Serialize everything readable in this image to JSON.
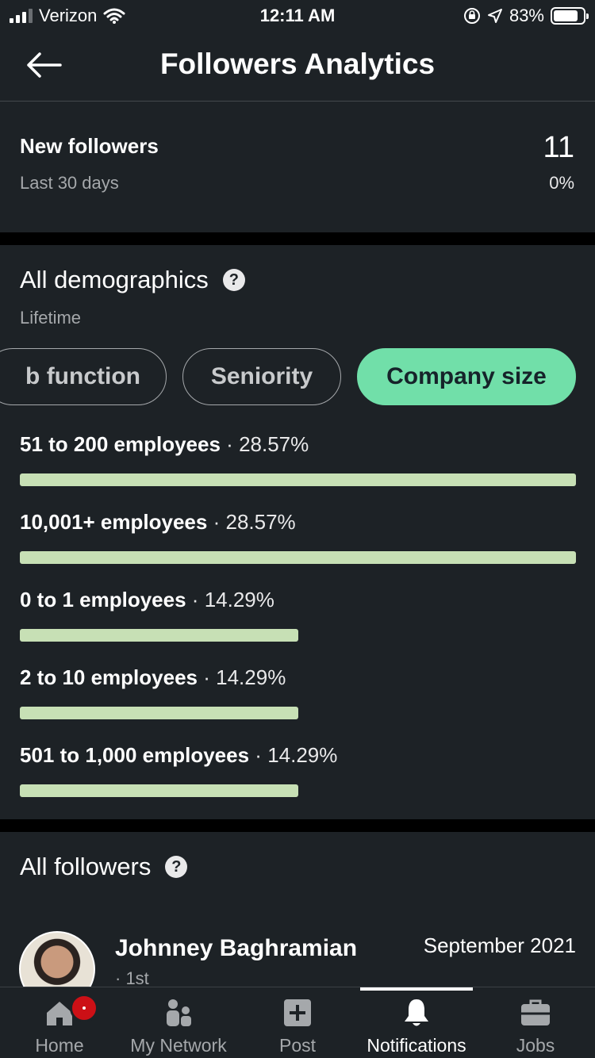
{
  "status_bar": {
    "carrier": "Verizon",
    "time": "12:11 AM",
    "battery": "83%",
    "battery_level": 0.83
  },
  "header": {
    "title": "Followers Analytics"
  },
  "new_followers": {
    "label": "New followers",
    "period": "Last 30 days",
    "count": "11",
    "change": "0%"
  },
  "demographics": {
    "title": "All demographics",
    "period": "Lifetime",
    "tabs": [
      {
        "label": "b function"
      },
      {
        "label": "Seniority"
      },
      {
        "label": "Company size"
      }
    ],
    "active_tab": "Company size",
    "rows": [
      {
        "label": "51 to 200 employees",
        "sep": "·",
        "value": "28.57%",
        "fraction": 1.0
      },
      {
        "label": "10,001+ employees",
        "sep": "·",
        "value": "28.57%",
        "fraction": 1.0
      },
      {
        "label": "0 to 1 employees",
        "sep": "·",
        "value": "14.29%",
        "fraction": 0.5
      },
      {
        "label": "2 to 10 employees",
        "sep": "·",
        "value": "14.29%",
        "fraction": 0.5
      },
      {
        "label": "501 to 1,000 employees",
        "sep": "·",
        "value": "14.29%",
        "fraction": 0.5
      }
    ],
    "bar_color": "#c7e0b5"
  },
  "followers": {
    "title": "All followers",
    "items": [
      {
        "name": "Johnney Baghramian",
        "degree": "· 1st",
        "date": "September 2021"
      }
    ]
  },
  "nav": {
    "items": [
      {
        "label": "Home",
        "icon": "home-icon"
      },
      {
        "label": "My Network",
        "icon": "network-icon"
      },
      {
        "label": "Post",
        "icon": "post-icon"
      },
      {
        "label": "Notifications",
        "icon": "bell-icon"
      },
      {
        "label": "Jobs",
        "icon": "briefcase-icon"
      }
    ],
    "active": "Notifications"
  },
  "colors": {
    "background": "#1d2226",
    "accent_pill": "#71dfa9",
    "badge": "#cc1016"
  }
}
